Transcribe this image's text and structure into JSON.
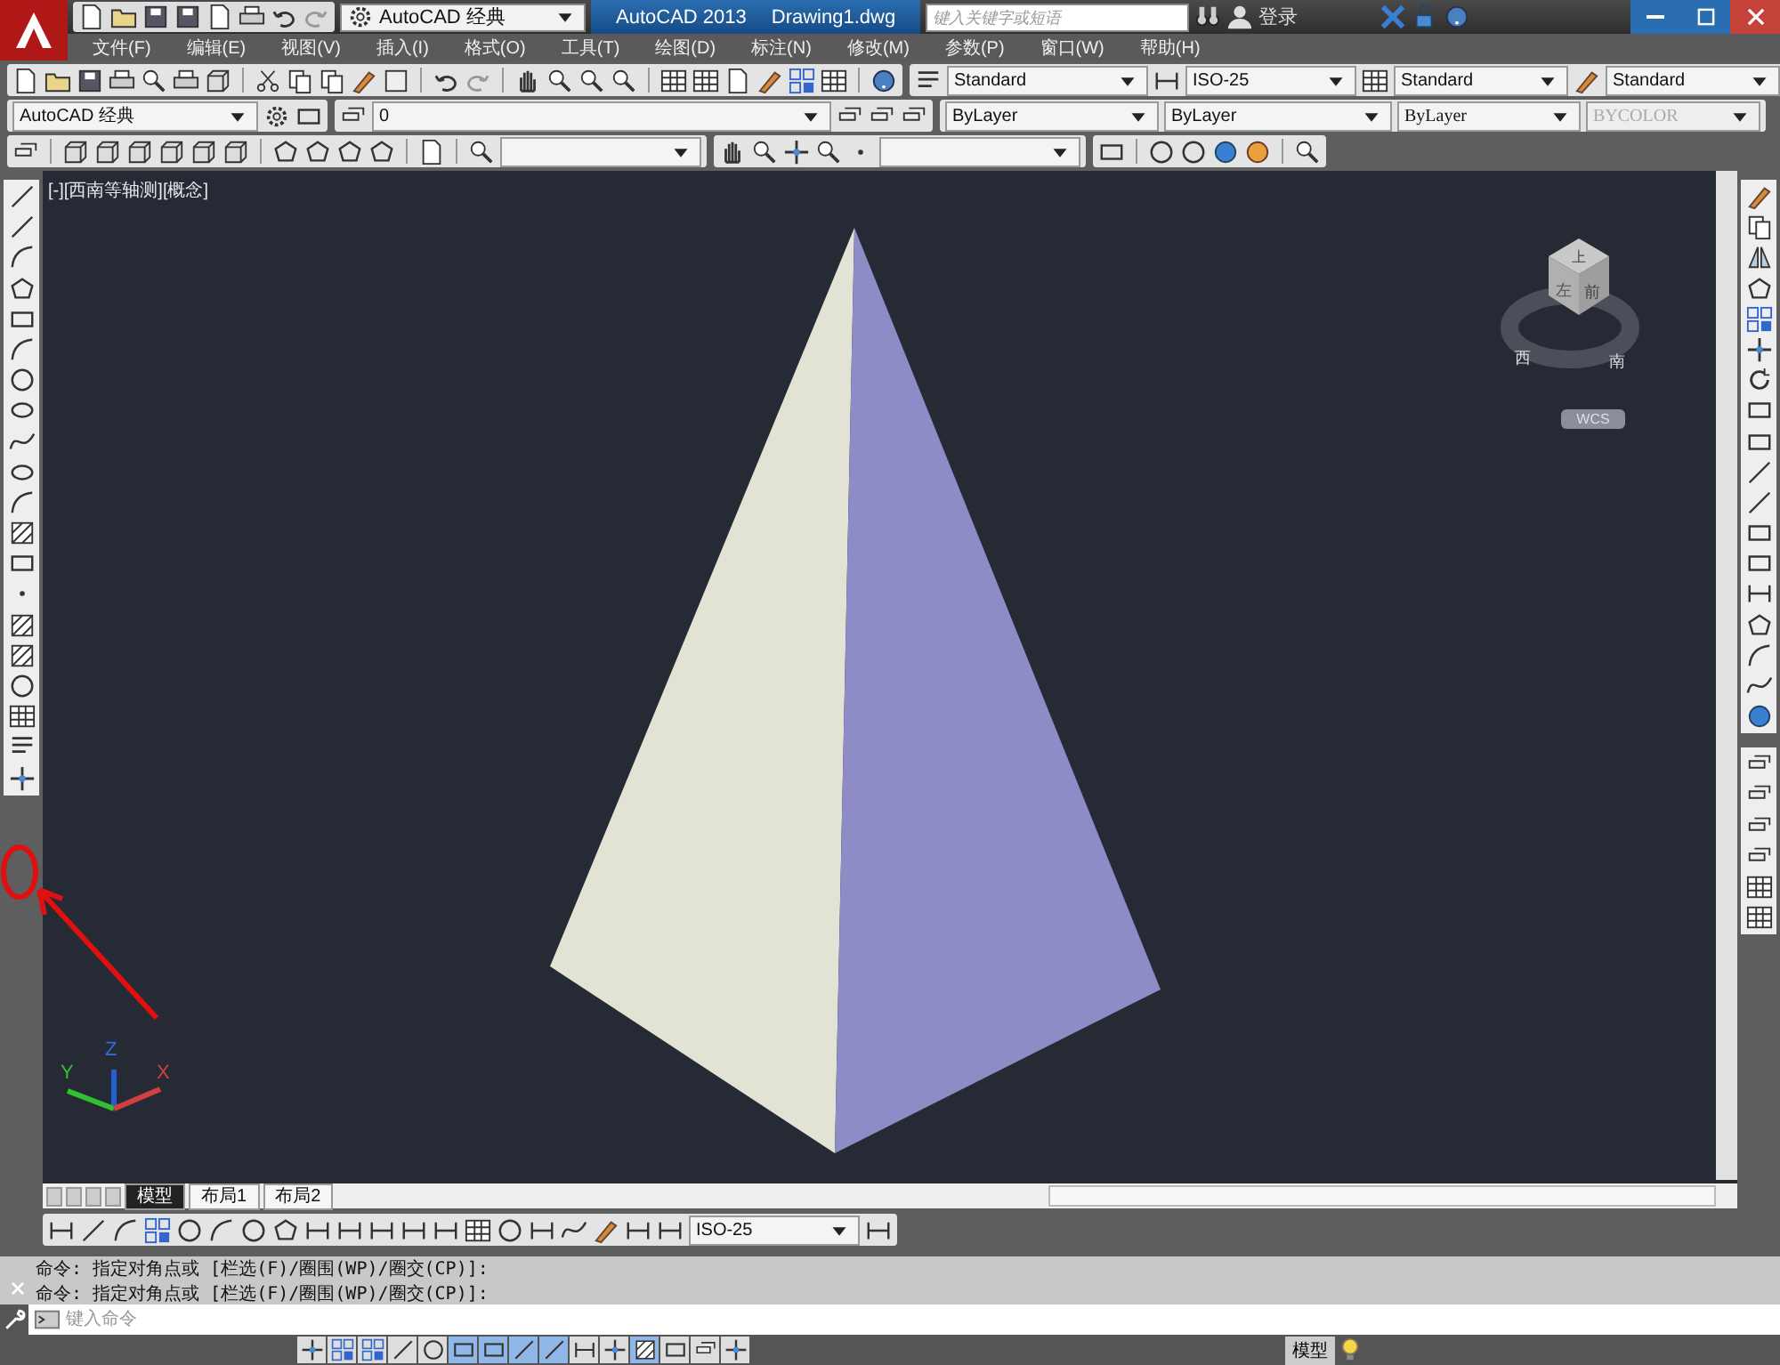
{
  "title_bar": {
    "workspace": "AutoCAD 经典",
    "app_title": "AutoCAD 2013",
    "file_name": "Drawing1.dwg",
    "search": {
      "placeholder": "键入关键字或短语"
    },
    "sign_in": "登录"
  },
  "menu_bar": [
    "文件(F)",
    "编辑(E)",
    "视图(V)",
    "插入(I)",
    "格式(O)",
    "工具(T)",
    "绘图(D)",
    "标注(N)",
    "修改(M)",
    "参数(P)",
    "窗口(W)",
    "帮助(H)"
  ],
  "styles_toolbar": {
    "text_style": "Standard",
    "dim_style": "ISO-25",
    "table_style": "Standard",
    "multileader_style": "Standard"
  },
  "properties_toolbar": {
    "workspace": "AutoCAD 经典",
    "layer": "0",
    "object_color": "ByLayer",
    "linetype": "ByLayer",
    "lineweight": "ByLayer",
    "plot_style": {
      "value": "BYCOLOR",
      "disabled": true
    }
  },
  "viewport": {
    "label": "[-][西南等轴测][概念]",
    "viewcube": {
      "faces": [
        "上",
        "左",
        "前"
      ],
      "compass": [
        "西",
        "南"
      ],
      "ucs_menu": "WCS"
    },
    "ucs_axes": [
      "X",
      "Y",
      "Z"
    ]
  },
  "layout_tabs": [
    {
      "label": "模型",
      "selected": true
    },
    {
      "label": "布局1",
      "selected": false
    },
    {
      "label": "布局2",
      "selected": false
    }
  ],
  "dimension_toolbar": {
    "dim_style": "ISO-25"
  },
  "command_history": [
    "命令: 指定对角点或 [栏选(F)/圈围(WP)/圈交(CP)]:",
    "命令: 指定对角点或 [栏选(F)/圈围(WP)/圈交(CP)]:"
  ],
  "command_line": {
    "placeholder": "键入命令"
  },
  "status_bar": {
    "space": "模型",
    "toggles": [
      {
        "on": false
      },
      {
        "on": false
      },
      {
        "on": false
      },
      {
        "on": false
      },
      {
        "on": false
      },
      {
        "on": true
      },
      {
        "on": true
      },
      {
        "on": true
      },
      {
        "on": true
      },
      {
        "on": false
      },
      {
        "on": false
      },
      {
        "on": true
      },
      {
        "on": false
      },
      {
        "on": false
      },
      {
        "on": false
      }
    ]
  }
}
